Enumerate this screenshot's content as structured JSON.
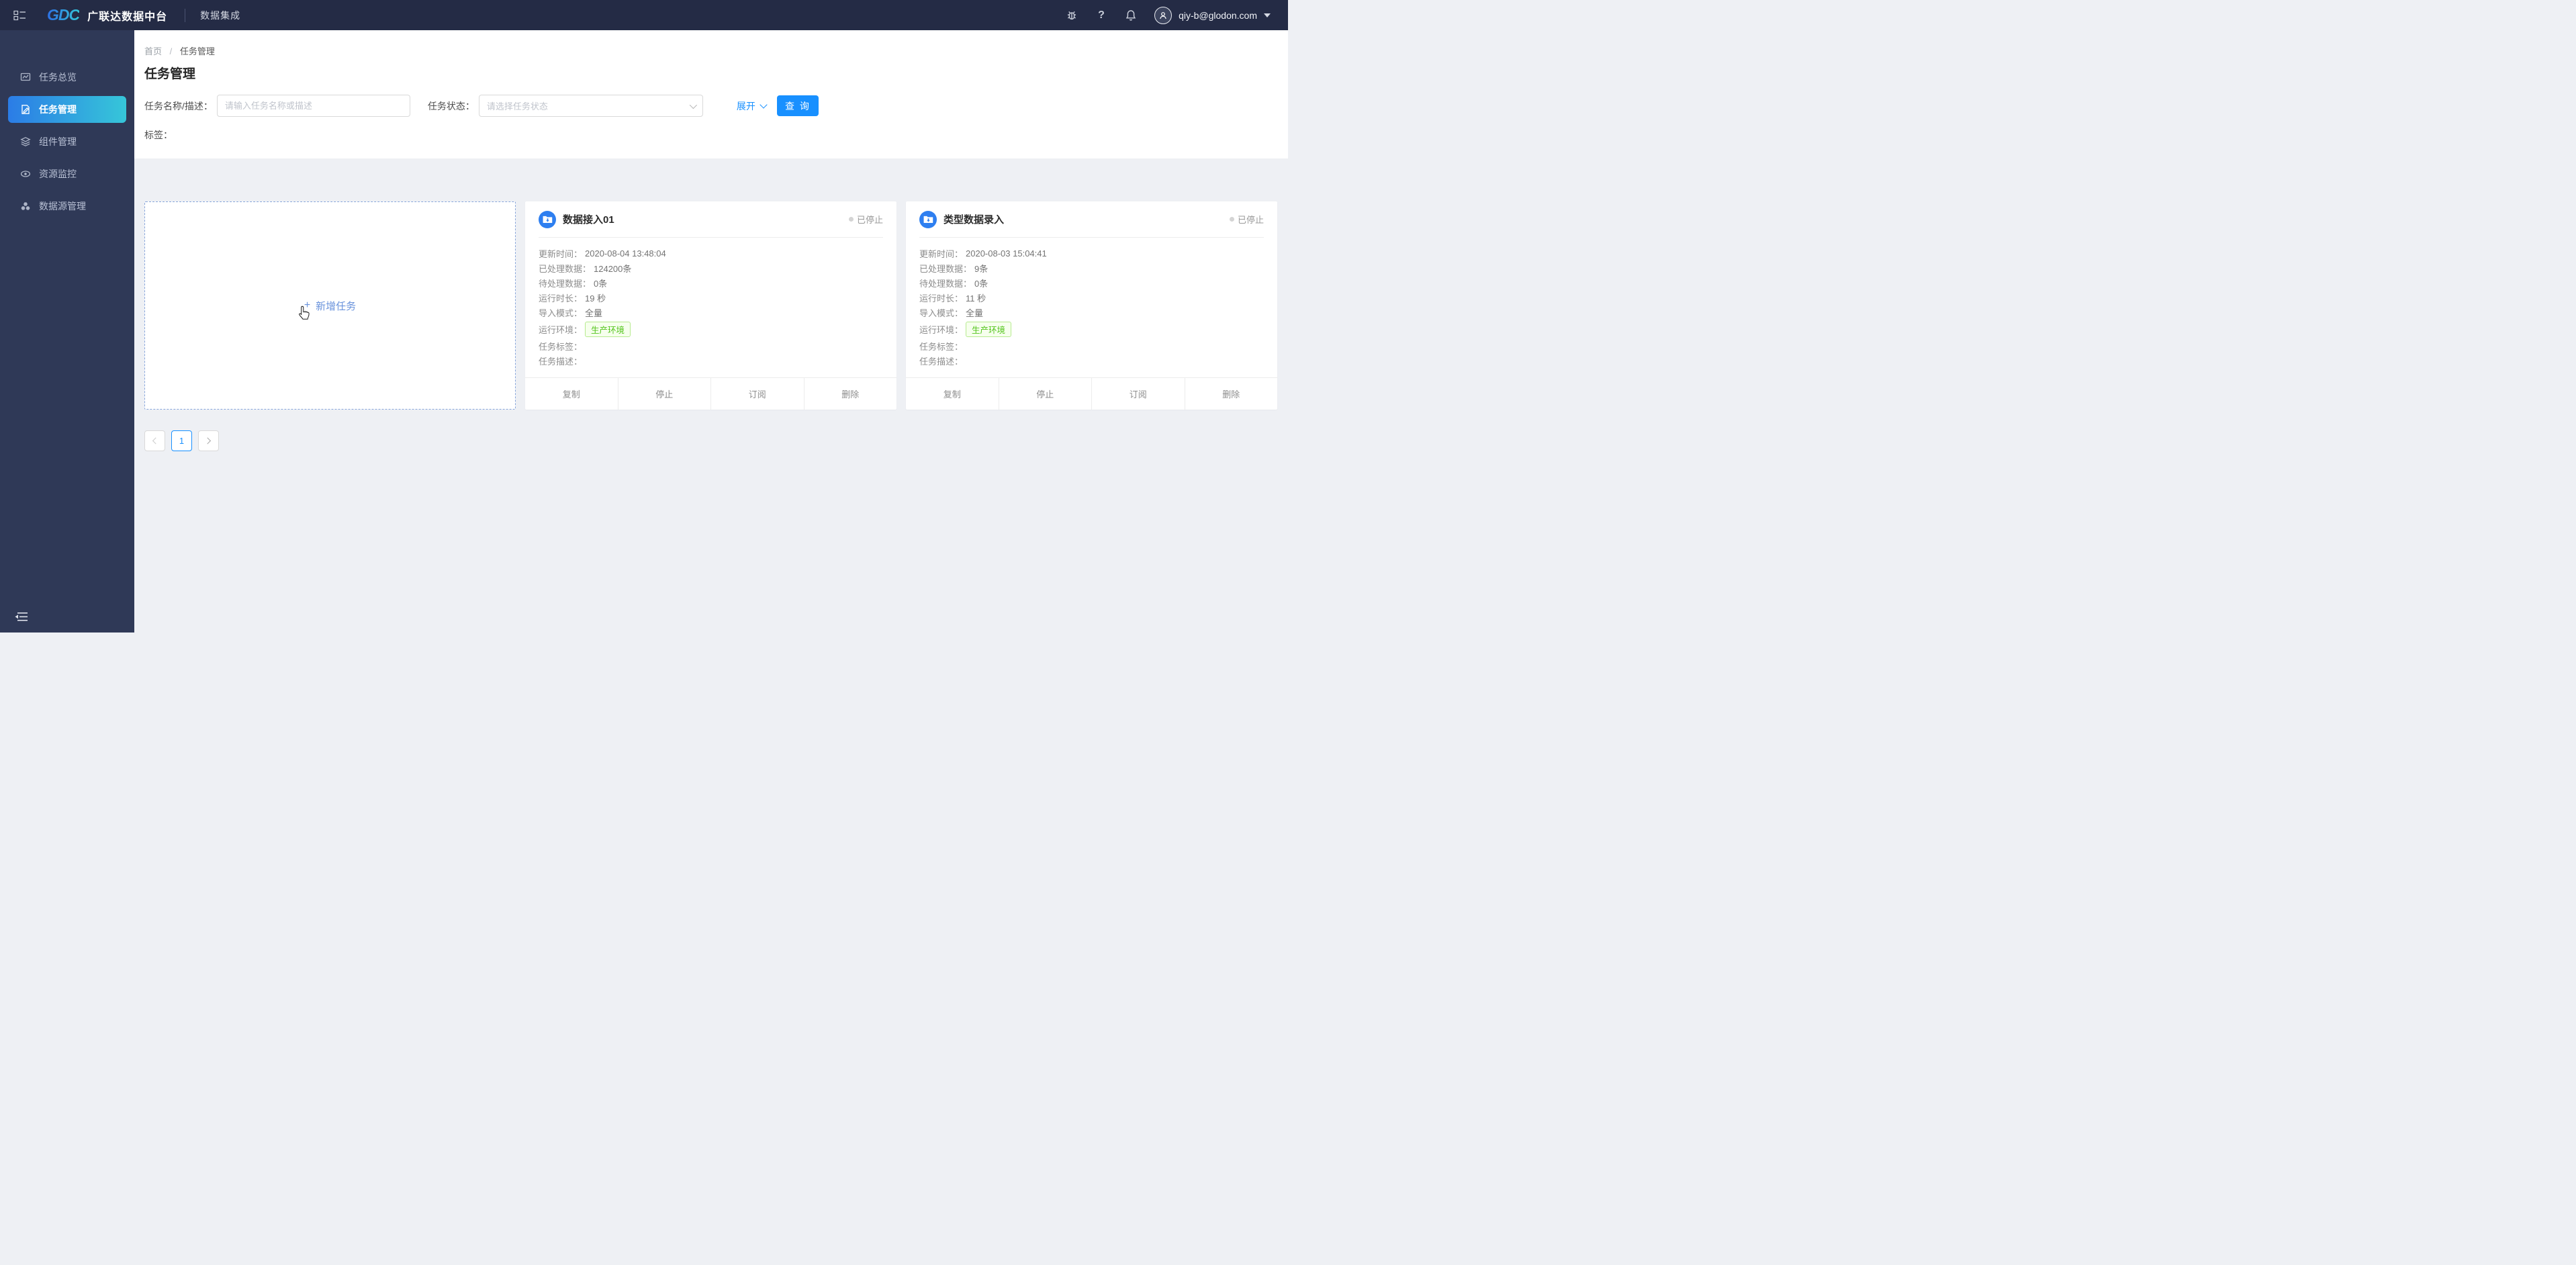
{
  "header": {
    "brand_logo": "GDC",
    "brand_title": "广联达数据中台",
    "module_title": "数据集成",
    "user_email": "qiy-b@glodon.com"
  },
  "sidebar": {
    "items": [
      {
        "label": "任务总览",
        "icon": "dashboard-chart-icon",
        "active": false
      },
      {
        "label": "任务管理",
        "icon": "task-edit-icon",
        "active": true
      },
      {
        "label": "组件管理",
        "icon": "layers-icon",
        "active": false
      },
      {
        "label": "资源监控",
        "icon": "eye-icon",
        "active": false
      },
      {
        "label": "数据源管理",
        "icon": "datasource-icon",
        "active": false
      }
    ]
  },
  "breadcrumb": {
    "home": "首页",
    "separator": "/",
    "current": "任务管理"
  },
  "page": {
    "title": "任务管理"
  },
  "filters": {
    "name_label": "任务名称/描述：",
    "name_placeholder": "请输入任务名称或描述",
    "status_label": "任务状态：",
    "status_placeholder": "请选择任务状态",
    "expand_label": "展开",
    "search_label": "查 询",
    "tag_label": "标签："
  },
  "add_card": {
    "plus": "+",
    "label": "新增任务"
  },
  "cards": [
    {
      "title": "数据接入01",
      "status": "已停止",
      "rows": [
        {
          "label": "更新时间：",
          "value": "2020-08-04 13:48:04"
        },
        {
          "label": "已处理数据：",
          "value": "124200条"
        },
        {
          "label": "待处理数据：",
          "value": "0条"
        },
        {
          "label": "运行时长：",
          "value": "19 秒"
        },
        {
          "label": "导入模式：",
          "value": "全量"
        },
        {
          "label": "运行环境：",
          "value": "生产环境"
        },
        {
          "label": "任务标签：",
          "value": ""
        },
        {
          "label": "任务描述：",
          "value": ""
        }
      ],
      "actions": [
        "复制",
        "停止",
        "订阅",
        "删除"
      ]
    },
    {
      "title": "类型数据录入",
      "status": "已停止",
      "rows": [
        {
          "label": "更新时间：",
          "value": "2020-08-03 15:04:41"
        },
        {
          "label": "已处理数据：",
          "value": "9条"
        },
        {
          "label": "待处理数据：",
          "value": "0条"
        },
        {
          "label": "运行时长：",
          "value": "11 秒"
        },
        {
          "label": "导入模式：",
          "value": "全量"
        },
        {
          "label": "运行环境：",
          "value": "生产环境"
        },
        {
          "label": "任务标签：",
          "value": ""
        },
        {
          "label": "任务描述：",
          "value": ""
        }
      ],
      "actions": [
        "复制",
        "停止",
        "订阅",
        "删除"
      ]
    }
  ],
  "pagination": {
    "current": "1"
  },
  "icons": {
    "header_left": [
      "collapse-menu-icon"
    ],
    "header_right": [
      "bug-icon",
      "help-icon",
      "bell-icon",
      "avatar",
      "caret-down-icon"
    ],
    "card": "folder-download-icon",
    "cursor": "hand-pointer-cursor",
    "sidebar_bottom": "menu-fold-icon"
  },
  "colors": {
    "header_bg": "#242b45",
    "sidebar_bg": "#2f3957",
    "active_gradient_start": "#2b7ce6",
    "active_gradient_end": "#36c6d9",
    "primary_blue": "#1890ff",
    "link_blue": "#6a93dc",
    "dashed_border": "#87a5da",
    "tag_green_text": "#52c41a",
    "tag_green_bg": "#f6ffed",
    "tag_green_border": "#b7eb8f",
    "status_grey": "#999999",
    "content_bg": "#eef0f4"
  }
}
